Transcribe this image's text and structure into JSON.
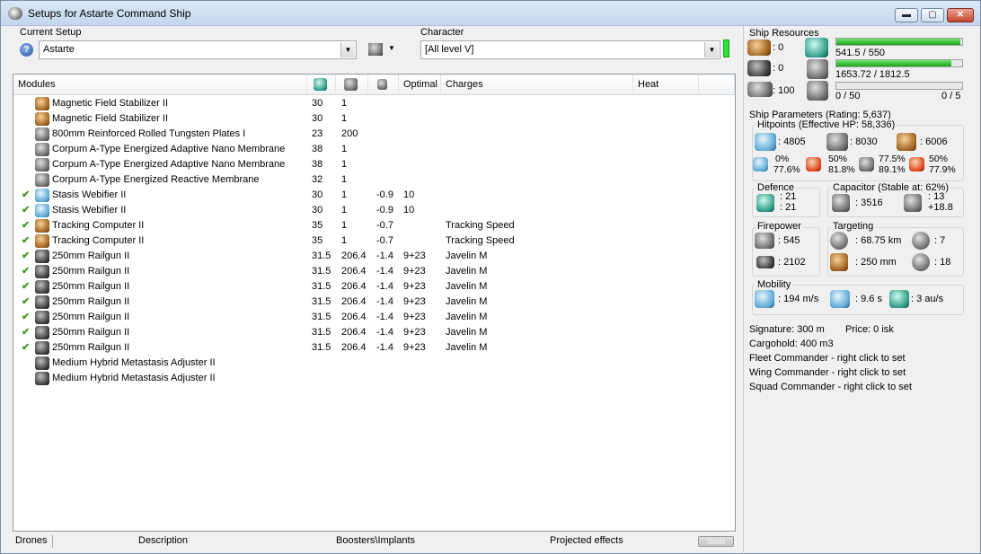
{
  "window": {
    "title": "Setups for Astarte Command Ship",
    "buttons": {
      "minimize": "▬",
      "maximize": "▢",
      "close": "✕"
    }
  },
  "setup": {
    "current_label": "Current Setup",
    "current_value": "Astarte",
    "character_label": "Character",
    "character_value": "[All level V]"
  },
  "grid": {
    "headers": {
      "modules": "Modules",
      "col_cpu": "cpu-icon",
      "col_pg": "powergrid-icon",
      "col_cap": "capacitor-icon",
      "optimal": "Optimal",
      "charges": "Charges",
      "heat": "Heat"
    },
    "rows": [
      {
        "active": false,
        "icon": "brown",
        "name": "Magnetic Field Stabilizer II",
        "cpu": "30",
        "pg": "1",
        "cap": "",
        "optimal": "",
        "charges": ""
      },
      {
        "active": false,
        "icon": "brown",
        "name": "Magnetic Field Stabilizer II",
        "cpu": "30",
        "pg": "1",
        "cap": "",
        "optimal": "",
        "charges": ""
      },
      {
        "active": false,
        "icon": "gray",
        "name": "800mm Reinforced Rolled Tungsten Plates I",
        "cpu": "23",
        "pg": "200",
        "cap": "",
        "optimal": "",
        "charges": ""
      },
      {
        "active": false,
        "icon": "gray",
        "name": "Corpum A-Type Energized Adaptive Nano Membrane",
        "cpu": "38",
        "pg": "1",
        "cap": "",
        "optimal": "",
        "charges": ""
      },
      {
        "active": false,
        "icon": "gray",
        "name": "Corpum A-Type Energized Adaptive Nano Membrane",
        "cpu": "38",
        "pg": "1",
        "cap": "",
        "optimal": "",
        "charges": ""
      },
      {
        "active": false,
        "icon": "gray",
        "name": "Corpum A-Type Energized Reactive Membrane",
        "cpu": "32",
        "pg": "1",
        "cap": "",
        "optimal": "",
        "charges": ""
      },
      {
        "active": true,
        "icon": "blue",
        "name": "Stasis Webifier II",
        "cpu": "30",
        "pg": "1",
        "cap": "-0.9",
        "optimal": "10",
        "charges": ""
      },
      {
        "active": true,
        "icon": "blue",
        "name": "Stasis Webifier II",
        "cpu": "30",
        "pg": "1",
        "cap": "-0.9",
        "optimal": "10",
        "charges": ""
      },
      {
        "active": true,
        "icon": "brown",
        "name": "Tracking Computer II",
        "cpu": "35",
        "pg": "1",
        "cap": "-0.7",
        "optimal": "",
        "charges": "Tracking Speed"
      },
      {
        "active": true,
        "icon": "brown",
        "name": "Tracking Computer II",
        "cpu": "35",
        "pg": "1",
        "cap": "-0.7",
        "optimal": "",
        "charges": "Tracking Speed"
      },
      {
        "active": true,
        "icon": "dark",
        "name": "250mm Railgun II",
        "cpu": "31.5",
        "pg": "206.4",
        "cap": "-1.4",
        "optimal": "9+23",
        "charges": "Javelin M"
      },
      {
        "active": true,
        "icon": "dark",
        "name": "250mm Railgun II",
        "cpu": "31.5",
        "pg": "206.4",
        "cap": "-1.4",
        "optimal": "9+23",
        "charges": "Javelin M"
      },
      {
        "active": true,
        "icon": "dark",
        "name": "250mm Railgun II",
        "cpu": "31.5",
        "pg": "206.4",
        "cap": "-1.4",
        "optimal": "9+23",
        "charges": "Javelin M"
      },
      {
        "active": true,
        "icon": "dark",
        "name": "250mm Railgun II",
        "cpu": "31.5",
        "pg": "206.4",
        "cap": "-1.4",
        "optimal": "9+23",
        "charges": "Javelin M"
      },
      {
        "active": true,
        "icon": "dark",
        "name": "250mm Railgun II",
        "cpu": "31.5",
        "pg": "206.4",
        "cap": "-1.4",
        "optimal": "9+23",
        "charges": "Javelin M"
      },
      {
        "active": true,
        "icon": "dark",
        "name": "250mm Railgun II",
        "cpu": "31.5",
        "pg": "206.4",
        "cap": "-1.4",
        "optimal": "9+23",
        "charges": "Javelin M"
      },
      {
        "active": true,
        "icon": "dark",
        "name": "250mm Railgun II",
        "cpu": "31.5",
        "pg": "206.4",
        "cap": "-1.4",
        "optimal": "9+23",
        "charges": "Javelin M"
      },
      {
        "active": false,
        "icon": "dark",
        "name": "Medium Hybrid Metastasis Adjuster II",
        "cpu": "",
        "pg": "",
        "cap": "",
        "optimal": "",
        "charges": ""
      },
      {
        "active": false,
        "icon": "dark",
        "name": "Medium Hybrid Metastasis Adjuster II",
        "cpu": "",
        "pg": "",
        "cap": "",
        "optimal": "",
        "charges": ""
      }
    ]
  },
  "bottom_tabs": {
    "drones": "Drones",
    "description": "Description",
    "boosters": "Boosters\\Implants",
    "projected": "Projected effects",
    "stats": "Stats"
  },
  "resources": {
    "title": "Ship Resources",
    "hardpoint_turrets": ": 0",
    "hardpoint_launchers": ": 0",
    "calibration": ": 100",
    "cpu_text": "541.5 / 550",
    "cpu_fraction": 0.985,
    "pg_text": "1653.72 / 1812.5",
    "pg_fraction": 0.912,
    "drone_bay_text": "0 / 50",
    "drone_bay_fraction": 0,
    "drones_active_text": "0 / 5"
  },
  "parameters": {
    "title": "Ship Parameters (Rating: 5,637)",
    "hitpoints_title": "Hitpoints (Effective HP: 58,336)",
    "shield_hp": ": 4805",
    "armor_hp": ": 8030",
    "structure_hp": ": 6006",
    "resists": [
      {
        "icon": "em-icon",
        "top": "0%",
        "bottom": "77.6%"
      },
      {
        "icon": "thermal-icon",
        "top": "50%",
        "bottom": "81.8%"
      },
      {
        "icon": "kinetic-icon",
        "top": "77.5%",
        "bottom": "89.1%"
      },
      {
        "icon": "explosive-icon",
        "top": "50%",
        "bottom": "77.9%"
      }
    ],
    "defence_title": "Defence",
    "defence_top": ": 21",
    "defence_bottom": ": 21",
    "capacitor_title": "Capacitor (Stable at: 62%)",
    "capacitor_value": ": 3516",
    "cap_recharge_top": ": 13",
    "cap_recharge_bottom": "+18.8",
    "firepower_title": "Firepower",
    "firepower_dps": ": 545",
    "firepower_volley": ": 2102",
    "targeting_title": "Targeting",
    "target_range": ": 68.75 km",
    "max_targets": ": 7",
    "scan_res": ": 250 mm",
    "sensor_strength": ": 18",
    "mobility_title": "Mobility",
    "velocity": ": 194 m/s",
    "align_time": ": 9.6 s",
    "warp_speed": ": 3 au/s",
    "signature": "Signature: 300 m",
    "price": "Price: 0 isk",
    "cargohold": "Cargohold: 400 m3",
    "fleet_commander": "Fleet Commander - right click to set",
    "wing_commander": "Wing Commander - right click to set",
    "squad_commander": "Squad Commander - right click to set"
  }
}
